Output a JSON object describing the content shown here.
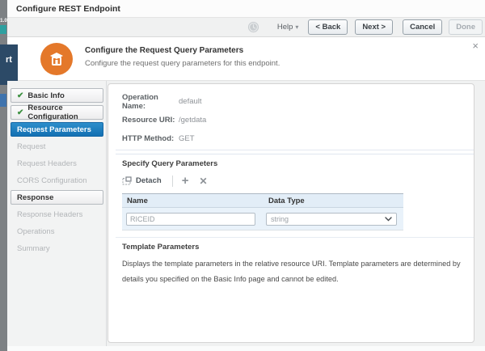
{
  "window": {
    "title": "Configure REST Endpoint"
  },
  "toolbar": {
    "help_label": "Help",
    "back_label": "< Back",
    "next_label": "Next >",
    "cancel_label": "Cancel",
    "done_label": "Done"
  },
  "background": {
    "version_label": "1.0",
    "banner_fragment": "rt"
  },
  "icons": {
    "check": "✔",
    "plus": "+",
    "delete": "✕",
    "help_chevron": "▾",
    "close": "×"
  },
  "colors": {
    "accent_orange": "#E4782A",
    "selected_step_blue": "#1B7CC2",
    "check_green": "#3E9142",
    "table_header_bg": "#E2EDF7",
    "table_row_bg": "#E9F2FA"
  },
  "dialog": {
    "title": "Configure the Request Query Parameters",
    "subtitle": "Configure the request query parameters for this endpoint.",
    "sidebar": {
      "items": [
        {
          "label": "Basic Info",
          "state": "completed"
        },
        {
          "label": "Resource Configuration",
          "state": "completed"
        },
        {
          "label": "Request Parameters",
          "state": "selected"
        },
        {
          "label": "Request",
          "state": "disabled"
        },
        {
          "label": "Request Headers",
          "state": "disabled"
        },
        {
          "label": "CORS Configuration",
          "state": "disabled"
        },
        {
          "label": "Response",
          "state": "enabled"
        },
        {
          "label": "Response Headers",
          "state": "disabled"
        },
        {
          "label": "Operations",
          "state": "disabled"
        },
        {
          "label": "Summary",
          "state": "disabled"
        }
      ]
    },
    "summary_fields": [
      {
        "label": "Operation Name:",
        "value": "default"
      },
      {
        "label": "Resource URI:",
        "value": "/getdata"
      },
      {
        "label": "HTTP Method:",
        "value": "GET"
      }
    ],
    "query_params": {
      "heading": "Specify Query Parameters",
      "detach_label": "Detach",
      "table": {
        "columns": [
          "Name",
          "Data Type"
        ],
        "row": {
          "name_value": "RICEID",
          "data_type_value": "string"
        }
      }
    },
    "template_params": {
      "heading": "Template Parameters",
      "description": "Displays the template parameters in the relative resource URI. Template parameters are determined by details you specified on the Basic Info page and cannot be edited."
    }
  }
}
